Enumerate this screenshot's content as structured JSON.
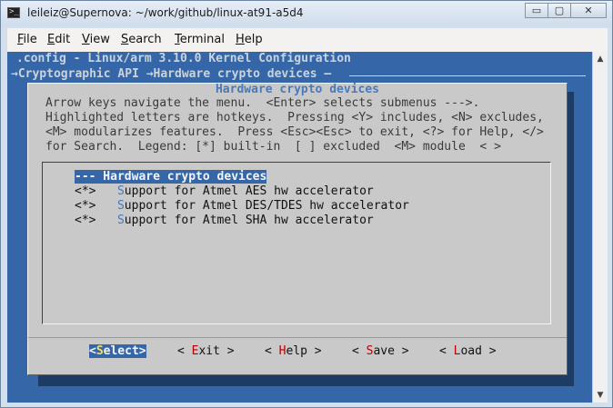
{
  "window": {
    "title": "leileiz@Supernova: ~/work/github/linux-at91-a5d4",
    "controls": {
      "minimize": "▭",
      "maximize": "▢",
      "close": "✕"
    }
  },
  "menubar": [
    {
      "hotkey": "F",
      "rest": "ile"
    },
    {
      "hotkey": "E",
      "rest": "dit"
    },
    {
      "hotkey": "V",
      "rest": "iew"
    },
    {
      "hotkey": "S",
      "rest": "earch"
    },
    {
      "hotkey": "T",
      "rest": "erminal"
    },
    {
      "hotkey": "H",
      "rest": "elp"
    }
  ],
  "terminal": {
    "header_line": ".config - Linux/arm 3.10.0 Kernel Configuration",
    "breadcrumb_line": "→Cryptographic API →Hardware crypto devices —"
  },
  "dialog": {
    "title": "Hardware crypto devices",
    "help_lines": [
      "Arrow keys navigate the menu.  <Enter> selects submenus --->.",
      "Highlighted letters are hotkeys.  Pressing <Y> includes, <N> excludes,",
      "<M> modularizes features.  Press <Esc><Esc> to exit, <?> for Help, </>",
      "for Search.  Legend: [*] built-in  [ ] excluded  <M> module  < >"
    ],
    "items": [
      {
        "prefix": "",
        "hotkey": "-",
        "text": "-- Hardware crypto devices",
        "selected": true
      },
      {
        "prefix": "<*>   ",
        "hotkey": "S",
        "text": "upport for Atmel AES hw accelerator",
        "selected": false
      },
      {
        "prefix": "<*>   ",
        "hotkey": "S",
        "text": "upport for Atmel DES/TDES hw accelerator",
        "selected": false
      },
      {
        "prefix": "<*>   ",
        "hotkey": "S",
        "text": "upport for Atmel SHA hw accelerator",
        "selected": false
      }
    ],
    "buttons": [
      {
        "open": "<",
        "hotkey": "S",
        "rest": "elect",
        "close": ">",
        "active": true
      },
      {
        "open": "< ",
        "hotkey": "E",
        "rest": "xit",
        "close": " >",
        "active": false
      },
      {
        "open": "< ",
        "hotkey": "H",
        "rest": "elp",
        "close": " >",
        "active": false
      },
      {
        "open": "< ",
        "hotkey": "S",
        "rest": "ave",
        "close": " >",
        "active": false
      },
      {
        "open": "< ",
        "hotkey": "L",
        "rest": "oad",
        "close": " >",
        "active": false
      }
    ]
  },
  "colors": {
    "terminal_bg": "#3567a8",
    "dialog_bg": "#c9c9c9",
    "hotkey_blue": "#4a7ab8",
    "hotkey_red": "#b30000"
  }
}
